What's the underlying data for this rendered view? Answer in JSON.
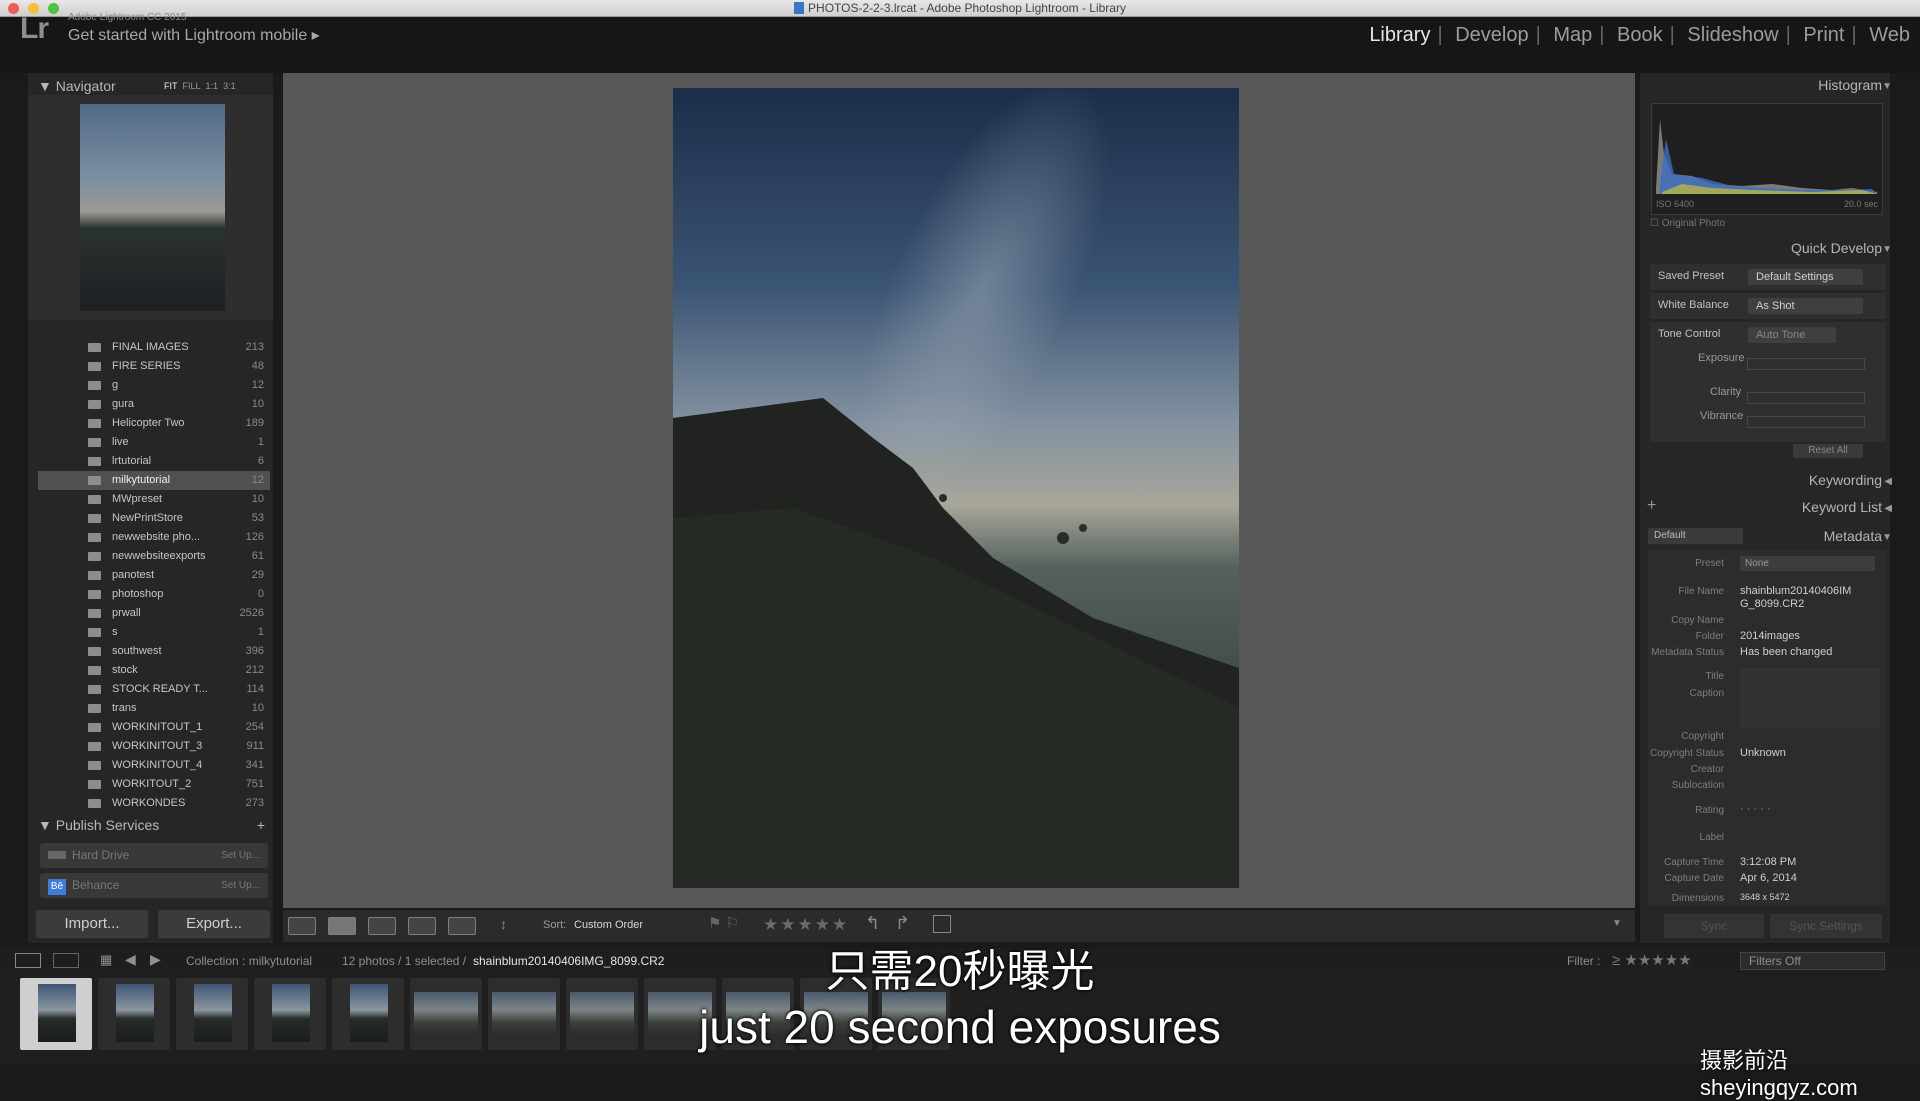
{
  "window": {
    "title": "PHOTOS-2-2-3.lrcat - Adobe Photoshop Lightroom - Library"
  },
  "header": {
    "version": "Adobe Lightroom CC 2015",
    "mobile_label": "Get started with Lightroom mobile",
    "logo": "Lr",
    "modules": [
      "Library",
      "Develop",
      "Map",
      "Book",
      "Slideshow",
      "Print",
      "Web"
    ],
    "active_module": "Library"
  },
  "navigator": {
    "title": "Navigator",
    "zoom_options": [
      "FIT",
      "FILL",
      "1:1",
      "3:1"
    ]
  },
  "folders": [
    {
      "name": "FINAL IMAGES",
      "count": "213"
    },
    {
      "name": "FIRE SERIES",
      "count": "48"
    },
    {
      "name": "g",
      "count": "12"
    },
    {
      "name": "gura",
      "count": "10"
    },
    {
      "name": "Helicopter Two",
      "count": "189"
    },
    {
      "name": "live",
      "count": "1"
    },
    {
      "name": "lrtutorial",
      "count": "6"
    },
    {
      "name": "milkytutorial",
      "count": "12"
    },
    {
      "name": "MWpreset",
      "count": "10"
    },
    {
      "name": "NewPrintStore",
      "count": "53"
    },
    {
      "name": "newwebsite pho...",
      "count": "126"
    },
    {
      "name": "newwebsiteexports",
      "count": "61"
    },
    {
      "name": "panotest",
      "count": "29"
    },
    {
      "name": "photoshop",
      "count": "0"
    },
    {
      "name": "prwall",
      "count": "2526"
    },
    {
      "name": "s",
      "count": "1"
    },
    {
      "name": "southwest",
      "count": "396"
    },
    {
      "name": "stock",
      "count": "212"
    },
    {
      "name": "STOCK READY T...",
      "count": "114"
    },
    {
      "name": "trans",
      "count": "10"
    },
    {
      "name": "WORKINITOUT_1",
      "count": "254"
    },
    {
      "name": "WORKINITOUT_3",
      "count": "911"
    },
    {
      "name": "WORKINITOUT_4",
      "count": "341"
    },
    {
      "name": "WORKITOUT_2",
      "count": "751"
    },
    {
      "name": "WORKONDES",
      "count": "273"
    }
  ],
  "selected_folder": "milkytutorial",
  "publish": {
    "title": "Publish Services",
    "services": [
      {
        "name": "Hard Drive",
        "action": "Set Up..."
      },
      {
        "name": "Behance",
        "action": "Set Up..."
      }
    ]
  },
  "buttons": {
    "import": "Import...",
    "export": "Export..."
  },
  "toolbar": {
    "sort_label": "Sort:",
    "sort_value": "Custom Order",
    "stars": "★★★★★"
  },
  "histogram": {
    "title": "Histogram",
    "iso": "ISO 6400",
    "shutter": "20.0 sec",
    "original_photo": "Original Photo"
  },
  "quick_develop": {
    "title": "Quick Develop",
    "saved_preset_label": "Saved Preset",
    "saved_preset_value": "Default Settings",
    "white_balance_label": "White Balance",
    "white_balance_value": "As Shot",
    "tone_control_label": "Tone Control",
    "auto_tone": "Auto Tone",
    "exposure": "Exposure",
    "clarity": "Clarity",
    "vibrance": "Vibrance",
    "reset_all": "Reset All"
  },
  "right_sections": {
    "keywording": "Keywording",
    "keyword_list": "Keyword List",
    "metadata": "Metadata",
    "default": "Default"
  },
  "metadata": {
    "preset_label": "Preset",
    "preset_value": "None",
    "file_name_label": "File Name",
    "file_name_value": "shainblum20140406IM G_8099.CR2",
    "copy_name_label": "Copy Name",
    "folder_label": "Folder",
    "folder_value": "2014images",
    "status_label": "Metadata Status",
    "status_value": "Has been changed",
    "title_label": "Title",
    "caption_label": "Caption",
    "copyright_label": "Copyright",
    "copyright_status_label": "Copyright Status",
    "copyright_status_value": "Unknown",
    "creator_label": "Creator",
    "sublocation_label": "Sublocation",
    "rating_label": "Rating",
    "rating_value": "· · · · ·",
    "label_label": "Label",
    "capture_time_label": "Capture Time",
    "capture_time_value": "3:12:08 PM",
    "capture_date_label": "Capture Date",
    "capture_date_value": "Apr 6, 2014",
    "dimensions_label": "Dimensions",
    "dimensions_value": "3648 x 5472"
  },
  "sync": {
    "sync": "Sync",
    "sync_settings": "Sync Settings"
  },
  "filmbar": {
    "collection": "Collection : milkytutorial",
    "count": "12 photos / 1 selected /",
    "file": "shainblum20140406IMG_8099.CR2",
    "filter_label": "Filter :",
    "filter_value": "Filters Off"
  },
  "subtitles": {
    "cn": "只需20秒曝光",
    "en": "just 20 second exposures"
  },
  "watermark": "摄影前沿 sheyingqyz.com"
}
